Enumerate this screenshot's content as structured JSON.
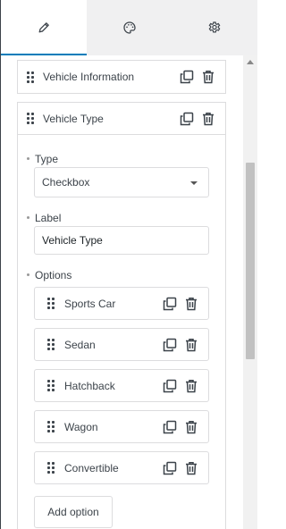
{
  "tabs": [
    {
      "name": "pencil-icon",
      "active": true
    },
    {
      "name": "palette-icon",
      "active": false
    },
    {
      "name": "gear-icon",
      "active": false
    }
  ],
  "panels": {
    "vehicle_information": {
      "title": "Vehicle Information"
    },
    "vehicle_type": {
      "title": "Vehicle Type",
      "type_label": "Type",
      "type_value": "Checkbox",
      "label_label": "Label",
      "label_value": "Vehicle Type",
      "options_label": "Options",
      "options": [
        "Sports Car",
        "Sedan",
        "Hatchback",
        "Wagon",
        "Convertible"
      ],
      "add_option_label": "Add option"
    }
  },
  "colors": {
    "accent": "#007cba",
    "border": "#dcdcde",
    "text": "#3c434a",
    "tabbar": "#f0f0f1"
  }
}
